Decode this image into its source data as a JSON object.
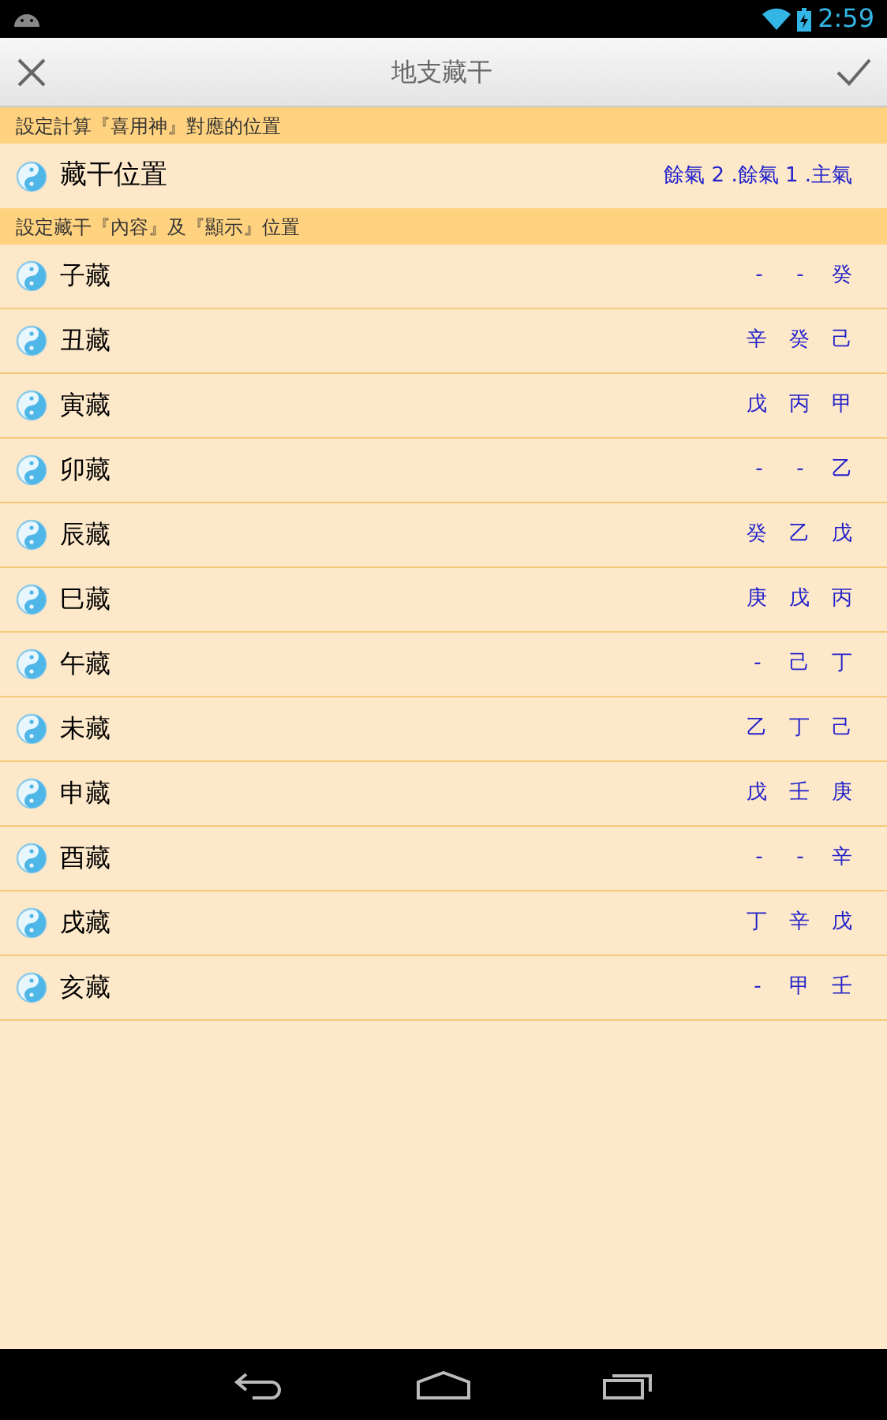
{
  "status_bar": {
    "time": "2:59"
  },
  "header": {
    "title": "地支藏干"
  },
  "sections": [
    {
      "title": "設定計算『喜用神』對應的位置",
      "rows": [
        {
          "label": "藏干位置",
          "values": [
            "餘氣 2 .餘氣 1 .主氣"
          ]
        }
      ]
    },
    {
      "title": "設定藏干『內容』及『顯示』位置",
      "rows": [
        {
          "label": "子藏",
          "values": [
            "-",
            "-",
            "癸"
          ]
        },
        {
          "label": "丑藏",
          "values": [
            "辛",
            "癸",
            "己"
          ]
        },
        {
          "label": "寅藏",
          "values": [
            "戊",
            "丙",
            "甲"
          ]
        },
        {
          "label": "卯藏",
          "values": [
            "-",
            "-",
            "乙"
          ]
        },
        {
          "label": "辰藏",
          "values": [
            "癸",
            "乙",
            "戊"
          ]
        },
        {
          "label": "巳藏",
          "values": [
            "庚",
            "戊",
            "丙"
          ]
        },
        {
          "label": "午藏",
          "values": [
            "-",
            "己",
            "丁"
          ]
        },
        {
          "label": "未藏",
          "values": [
            "乙",
            "丁",
            "己"
          ]
        },
        {
          "label": "申藏",
          "values": [
            "戊",
            "壬",
            "庚"
          ]
        },
        {
          "label": "酉藏",
          "values": [
            "-",
            "-",
            "辛"
          ]
        },
        {
          "label": "戌藏",
          "values": [
            "丁",
            "辛",
            "戊"
          ]
        },
        {
          "label": "亥藏",
          "values": [
            "-",
            "甲",
            "壬"
          ]
        }
      ]
    }
  ]
}
